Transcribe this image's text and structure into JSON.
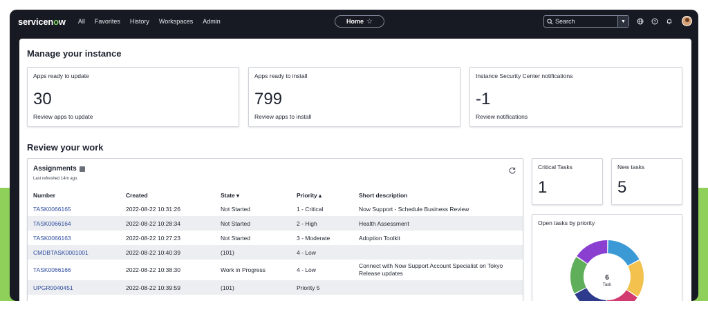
{
  "nav": {
    "logo_text": "servicen",
    "logo_o": "o",
    "logo_tail": "w",
    "links": [
      "All",
      "Favorites",
      "History",
      "Workspaces",
      "Admin"
    ],
    "home_label": "Home",
    "search_placeholder": "Search"
  },
  "manage": {
    "title": "Manage your instance",
    "cards": [
      {
        "title": "Apps ready to update",
        "value": "30",
        "link": "Review apps to update"
      },
      {
        "title": "Apps ready to install",
        "value": "799",
        "link": "Review apps to install"
      },
      {
        "title": "Instance Security Center notifications",
        "value": "-1",
        "link": "Review notifications"
      }
    ]
  },
  "review": {
    "title": "Review your work",
    "assignments": {
      "title": "Assignments",
      "refreshed": "Last refreshed 14m ago.",
      "columns": [
        "Number",
        "Created",
        "State",
        "Priority",
        "Short description"
      ],
      "rows": [
        {
          "number": "TASK0066165",
          "created": "2022-08-22 10:31:26",
          "state": "Not Started",
          "priority": "1 - Critical",
          "desc": "Now Support - Schedule Business Review"
        },
        {
          "number": "TASK0066164",
          "created": "2022-08-22 10:28:34",
          "state": "Not Started",
          "priority": "2 - High",
          "desc": "Health Assessment"
        },
        {
          "number": "TASK0066163",
          "created": "2022-08-22 10:27:23",
          "state": "Not Started",
          "priority": "3 - Moderate",
          "desc": "Adoption Toolkit"
        },
        {
          "number": "CMDBTASK0001001",
          "created": "2022-08-22 10:40:39",
          "state": "(101)",
          "priority": "4 - Low",
          "desc": ""
        },
        {
          "number": "TASK0066166",
          "created": "2022-08-22 10:38:30",
          "state": "Work in Progress",
          "priority": "4 - Low",
          "desc": "Connect with Now Support Account Specialist on Tokyo Release updates"
        },
        {
          "number": "UPGR0040451",
          "created": "2022-08-22 10:39:59",
          "state": "(101)",
          "priority": "Priority 5",
          "desc": ""
        }
      ]
    },
    "critical": {
      "title": "Critical Tasks",
      "value": "1"
    },
    "newtasks": {
      "title": "New tasks",
      "value": "5"
    },
    "donut": {
      "title": "Open tasks by priority",
      "center_value": "6",
      "center_label": "Task",
      "segments": [
        {
          "color": "#3b9ad6",
          "fraction": 0.17
        },
        {
          "color": "#f2c14e",
          "fraction": 0.17
        },
        {
          "color": "#d23b6f",
          "fraction": 0.16
        },
        {
          "color": "#2e3a8c",
          "fraction": 0.17
        },
        {
          "color": "#5fae5a",
          "fraction": 0.17
        },
        {
          "color": "#8a3fd1",
          "fraction": 0.16
        }
      ]
    }
  },
  "colors": {
    "accent": "#7fd35e",
    "link": "#2d4b9e",
    "frame": "#171a22",
    "band": "#8ed05a"
  }
}
